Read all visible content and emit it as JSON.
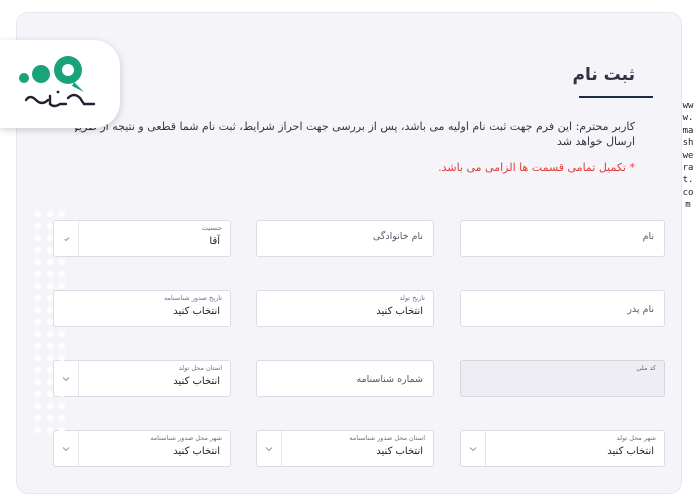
{
  "page": {
    "title": "ثبت نام",
    "intro_line1": "کاربر محترم: این فرم جهت ثبت نام اولیه می باشد، پس از بررسی جهت احراز شرایط، ثبت نام شما قطعی و نتیجه از طریق پیامک",
    "intro_line2": "ارسال خواهد شد",
    "required_note": "* تکمیل تمامی قسمت ها الزامی می باشد."
  },
  "form": {
    "first_name": {
      "placeholder": "نام"
    },
    "last_name": {
      "placeholder": "نام خانوادگی"
    },
    "gender": {
      "label": "جنسیت",
      "value": "آقا"
    },
    "father_name": {
      "placeholder": "نام پدر"
    },
    "birth_date": {
      "label": "تاریخ تولد",
      "value": "انتخاب کنید"
    },
    "id_issue_date": {
      "label": "تاریخ صدور شناسنامه",
      "value": "انتخاب کنید"
    },
    "national_code": {
      "label": "کد ملی"
    },
    "id_number": {
      "placeholder": "شماره شناسنامه"
    },
    "birth_province": {
      "label": "استان محل تولد",
      "value": "انتخاب کنید"
    },
    "birth_city": {
      "label": "شهر محل تولد",
      "value": "انتخاب کنید"
    },
    "issue_province": {
      "label": "استان محل صدور شناسنامه",
      "value": "انتخاب کنید"
    },
    "issue_city": {
      "label": "شهر محل صدور شناسنامه",
      "value": "انتخاب کنید"
    }
  },
  "brand": {
    "logo_text": "مشورت",
    "logo_color": "#1aa37a",
    "watermark": "www.mashwerat.com"
  },
  "colors": {
    "accent": "#1e2a4a",
    "required": "#e23b3b",
    "field_border": "#dcdce6"
  }
}
